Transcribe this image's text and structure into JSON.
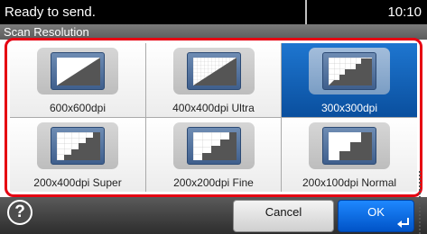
{
  "status": {
    "message": "Ready to send.",
    "time": "10:10"
  },
  "screen": {
    "title": "Scan Resolution"
  },
  "options": [
    {
      "label": "600x600dpi",
      "icon": "resolution-fine-grid-icon",
      "selected": false
    },
    {
      "label": "400x400dpi Ultra",
      "icon": "resolution-fine-grid-icon",
      "selected": false
    },
    {
      "label": "300x300dpi",
      "icon": "resolution-medium-grid-icon",
      "selected": true
    },
    {
      "label": "200x400dpi Super",
      "icon": "resolution-step-icon",
      "selected": false
    },
    {
      "label": "200x200dpi Fine",
      "icon": "resolution-step-icon",
      "selected": false
    },
    {
      "label": "200x100dpi Normal",
      "icon": "resolution-step-icon",
      "selected": false
    }
  ],
  "footer": {
    "help": "?",
    "cancel": "Cancel",
    "ok": "OK"
  },
  "colors": {
    "highlight_border": "#e60012",
    "selected_option": "#0a4f9e",
    "ok_button": "#1e88ff"
  }
}
